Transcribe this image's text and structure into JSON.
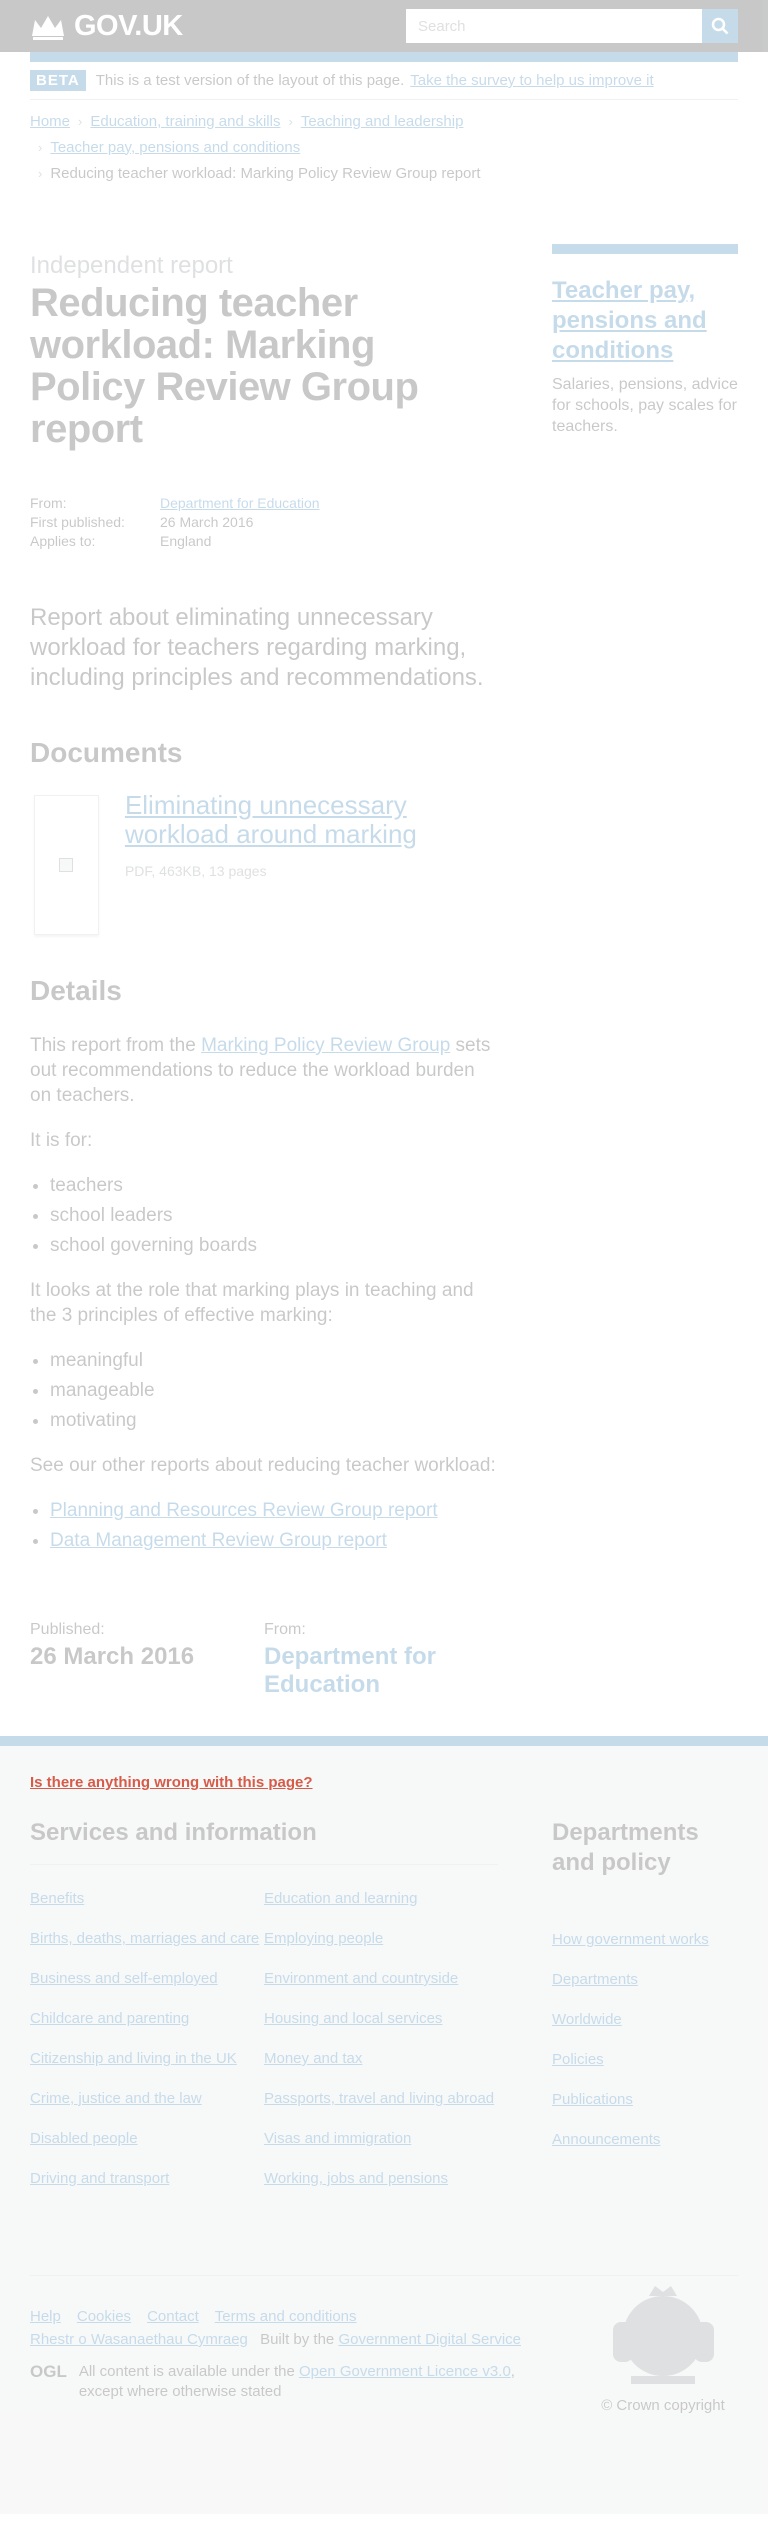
{
  "header": {
    "logo_text": "GOV.UK",
    "search_placeholder": "Search",
    "colors": {
      "black": "#0b0c0c",
      "link": "#005ea5"
    }
  },
  "beta_banner": {
    "tag": "BETA",
    "text": "This is a test version of the layout of this page.",
    "link": "Take the survey to help us improve it"
  },
  "breadcrumbs": {
    "items": [
      "Home",
      "Education, training and skills",
      "Teaching and leadership"
    ],
    "sub": "Teacher pay, pensions and conditions",
    "current": "Reducing teacher workload: Marking Policy Review Group report"
  },
  "main": {
    "kicker": "Independent report",
    "title": "Reducing teacher workload: Marking Policy Review Group report",
    "meta": {
      "from_label": "From:",
      "from_value": "Department for Education",
      "published_label": "First published:",
      "published_value": "26 March 2016",
      "applies_label": "Applies to:",
      "applies_value": "England"
    },
    "lead": "Report about eliminating unnecessary workload for teachers regarding marking, including principles and recommendations.",
    "documents_heading": "Documents",
    "document": {
      "title": "Eliminating unnecessary workload around marking",
      "meta": "PDF, 463KB, 13 pages"
    },
    "details_heading": "Details",
    "details": {
      "p1_pre": "This report from the",
      "p1_link": "Marking Policy Review Group",
      "p1_post": "sets out recommendations to reduce the workload burden on teachers.",
      "p2": "It is for:",
      "list1": [
        "teachers",
        "school leaders",
        "school governing boards"
      ],
      "p3": "It looks at the role that marking plays in teaching and the 3 principles of effective marking:",
      "list2": [
        "meaningful",
        "manageable",
        "motivating"
      ],
      "p4": "See our other reports about reducing teacher workload:",
      "links": [
        "Planning and Resources Review Group report",
        "Data Management Review Group report"
      ]
    },
    "published_label": "Published:",
    "published_value": "26 March 2016",
    "from_label": "From:",
    "from_value": "Department for Education",
    "useful": "Is there anything wrong with this page?"
  },
  "sidebar": {
    "title": "Teacher pay, pensions and conditions",
    "text": "Salaries, pensions, advice for schools, pay scales for teachers."
  },
  "footer": {
    "services_heading": "Services and information",
    "services_col1": [
      "Benefits",
      "Births, deaths, marriages and care",
      "Business and self-employed",
      "Childcare and parenting",
      "Citizenship and living in the UK",
      "Crime, justice and the law",
      "Disabled people",
      "Driving and transport"
    ],
    "services_col2": [
      "Education and learning",
      "Employing people",
      "Environment and countryside",
      "Housing and local services",
      "Money and tax",
      "Passports, travel and living abroad",
      "Visas and immigration",
      "Working, jobs and pensions"
    ],
    "departments_heading": "Departments and policy",
    "departments": [
      "How government works",
      "Departments",
      "Worldwide",
      "Policies",
      "Publications",
      "Announcements"
    ],
    "meta_links": [
      "Help",
      "Cookies",
      "Contact",
      "Terms and conditions"
    ],
    "welsh": "Rhestr o Wasanaethau Cymraeg",
    "built_pre": "Built by the",
    "built_link": "Government Digital Service",
    "ogl_logo": "OGL",
    "licence_pre": "All content is available under the",
    "licence_link": "Open Government Licence v3.0",
    "licence_post": ", except where otherwise stated",
    "copyright": "© Crown copyright"
  }
}
